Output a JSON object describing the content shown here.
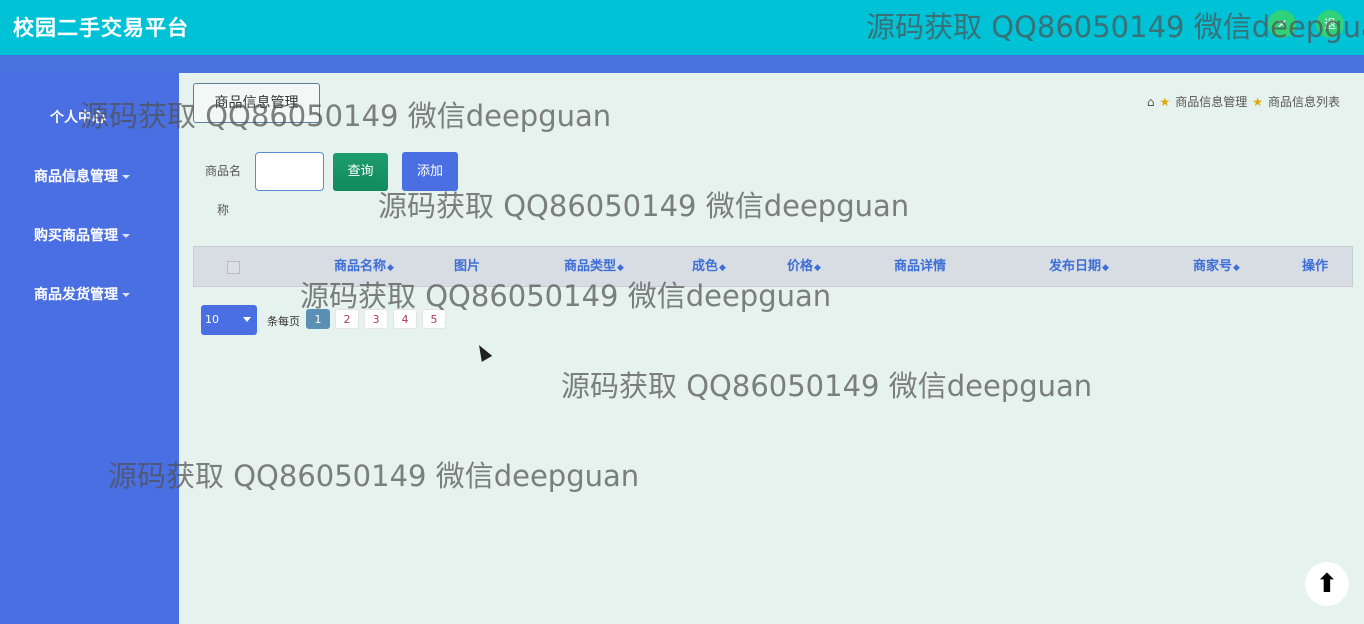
{
  "app": {
    "title": "校园二手交易平台"
  },
  "topbar": {
    "btn1": "✕",
    "btn2": "退"
  },
  "sidebar": {
    "items": [
      {
        "label": "个人中心",
        "caret": false
      },
      {
        "label": "商品信息管理",
        "caret": true
      },
      {
        "label": "购买商品管理",
        "caret": true
      },
      {
        "label": "商品发货管理",
        "caret": true
      }
    ]
  },
  "tab": {
    "label": "商品信息管理"
  },
  "breadcrumb": {
    "item1": "商品信息管理",
    "item2": "商品信息列表"
  },
  "search": {
    "label_line1": "商品名",
    "label_line2": "称",
    "value": "",
    "query_label": "查询",
    "add_label": "添加"
  },
  "table": {
    "columns": [
      "商品名称",
      "图片",
      "商品类型",
      "成色",
      "价格",
      "商品详情",
      "发布日期",
      "商家号",
      "操作"
    ],
    "sortable": [
      true,
      false,
      true,
      true,
      true,
      false,
      true,
      true,
      false
    ],
    "rows": []
  },
  "pagination": {
    "page_size": "10",
    "per_page_label": "条每页",
    "pages": [
      "1",
      "2",
      "3",
      "4",
      "5"
    ],
    "current": "1"
  },
  "watermark": "源码获取 QQ86050149 微信deepguan",
  "colors": {
    "topbar": "#00c2d6",
    "sidebar": "#4a6fe2",
    "content_bg": "#e6f2ee",
    "header_text": "#3d6fd6",
    "query_btn": "#1e9c6d"
  }
}
